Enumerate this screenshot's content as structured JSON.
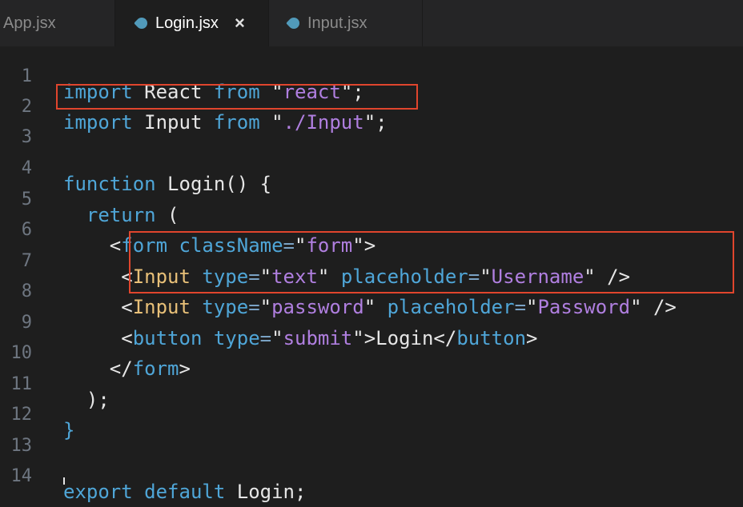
{
  "tabs": [
    {
      "label": "App.jsx",
      "active": false
    },
    {
      "label": "Login.jsx",
      "active": true,
      "close": "×"
    },
    {
      "label": "Input.jsx",
      "active": false
    }
  ],
  "editor": {
    "lines": [
      {
        "num": "1",
        "tokens": [
          "import",
          " React ",
          "from",
          " \"",
          "react",
          "\";"
        ]
      },
      {
        "num": "2",
        "tokens": [
          "import",
          " Input ",
          "from",
          " \"",
          "./Input",
          "\";"
        ]
      },
      {
        "num": "3"
      },
      {
        "num": "4",
        "tokens": [
          "function",
          " Login",
          "() {"
        ]
      },
      {
        "num": "5",
        "tokens": [
          "  return",
          " ("
        ]
      },
      {
        "num": "6",
        "tokens": [
          "    <",
          "form",
          " ",
          "className",
          "=",
          "\"",
          "form",
          "\">"
        ]
      },
      {
        "num": "7",
        "tokens": [
          "     <",
          "Input",
          " ",
          "type",
          "=",
          "\"",
          "text",
          "\" ",
          "placeholder",
          "=",
          "\"",
          "Username",
          "\" />"
        ]
      },
      {
        "num": "8",
        "tokens": [
          "     <",
          "Input",
          " ",
          "type",
          "=",
          "\"",
          "password",
          "\" ",
          "placeholder",
          "=",
          "\"",
          "Password",
          "\" />"
        ]
      },
      {
        "num": "9",
        "tokens": [
          "     <",
          "button",
          " ",
          "type",
          "=",
          "\"",
          "submit",
          "\">",
          "Login",
          "</",
          "button",
          ">"
        ]
      },
      {
        "num": "10",
        "tokens": [
          "    </",
          "form",
          ">"
        ]
      },
      {
        "num": "11",
        "tokens": [
          "  );"
        ]
      },
      {
        "num": "12",
        "tokens": [
          "}"
        ]
      },
      {
        "num": "13"
      },
      {
        "num": "14",
        "tokens": [
          "export",
          " ",
          "default",
          " Login;"
        ]
      }
    ]
  },
  "colors": {
    "keyword": "#4fa6d8",
    "component": "#e8c078",
    "string": "#b07fe0",
    "highlight_box": "#e0452d",
    "tab_icon": "#519aba"
  }
}
